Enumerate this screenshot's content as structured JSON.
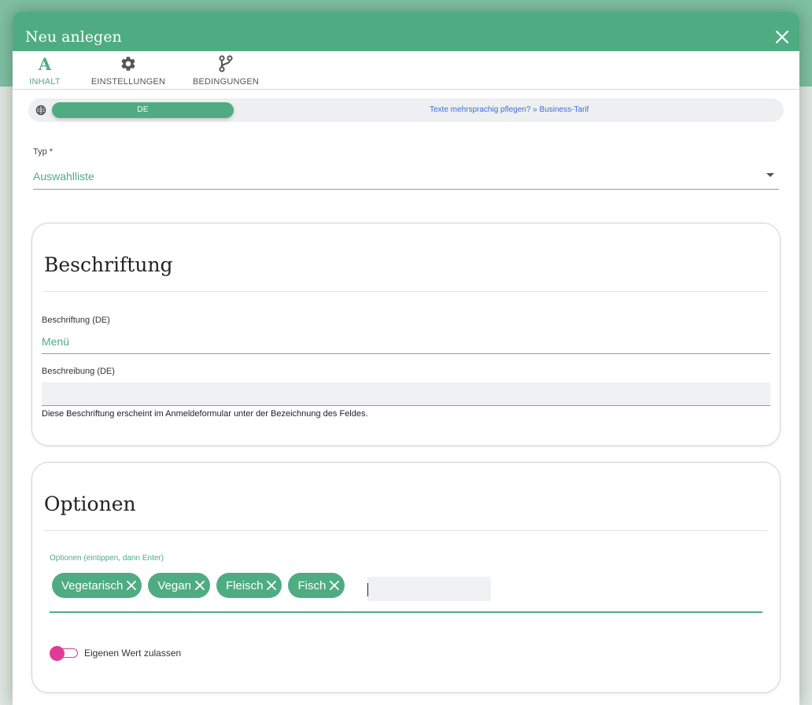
{
  "dialog": {
    "title": "Neu anlegen"
  },
  "tabs": [
    {
      "label": "INHALT",
      "icon": "letter-a-icon",
      "active": true
    },
    {
      "label": "EINSTELLUNGEN",
      "icon": "gear-icon",
      "active": false
    },
    {
      "label": "BEDINGUNGEN",
      "icon": "branch-icon",
      "active": false
    }
  ],
  "language": {
    "active": "DE",
    "upsell_link": "Texte mehrsprachig pflegen? » Business-Tarif"
  },
  "type_field": {
    "label": "Typ *",
    "value": "Auswahlliste"
  },
  "label_card": {
    "title": "Beschriftung",
    "label_field": {
      "label": "Beschriftung (DE)",
      "value": "Menü"
    },
    "description_field": {
      "label": "Beschreibung (DE)",
      "value": ""
    },
    "hint": "Diese Beschriftung erscheint im Anmeldeformular unter der Bezeichnung des Feldes."
  },
  "options_card": {
    "title": "Optionen",
    "input_label": "Optionen (eintippen, dann Enter)",
    "chips": [
      "Vegetarisch",
      "Vegan",
      "Fleisch",
      "Fisch"
    ],
    "allow_custom": {
      "label": "Eigenen Wert zulassen",
      "enabled": false
    }
  },
  "colors": {
    "primary": "#4fac82",
    "toggle": "#e23a9a",
    "link": "#3d6fd0"
  }
}
